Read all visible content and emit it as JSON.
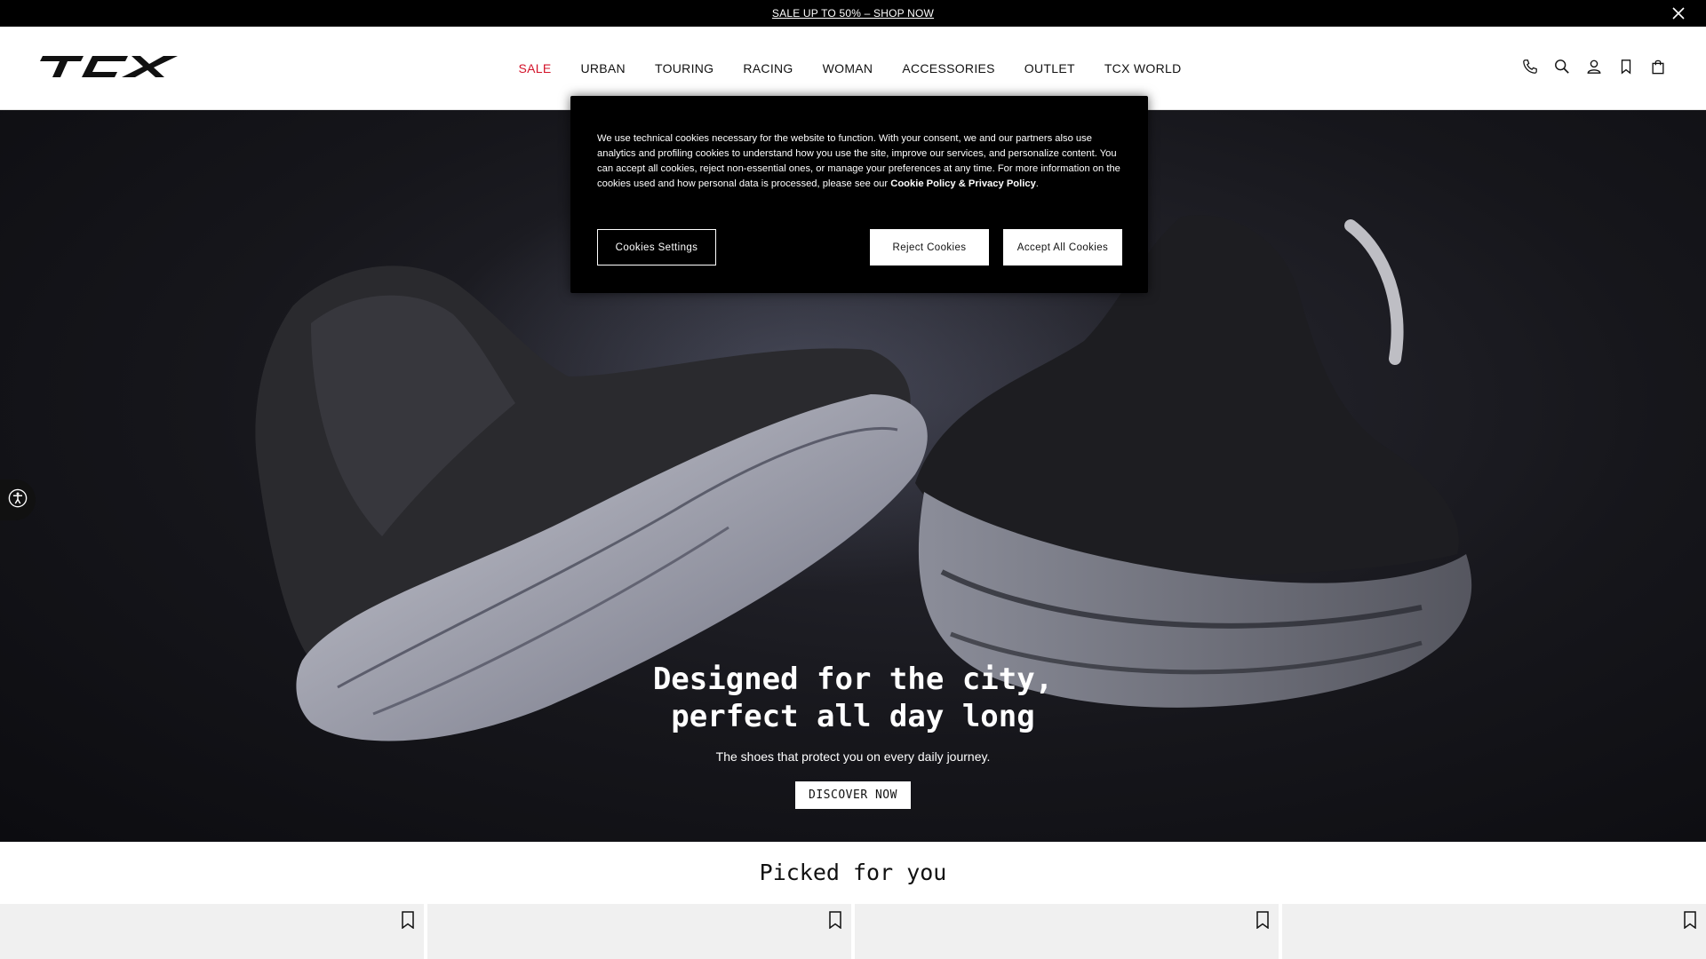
{
  "promo": {
    "text": "SALE UP TO 50% – SHOP NOW"
  },
  "header": {
    "logo_text": "TCX",
    "nav": [
      {
        "label": "SALE"
      },
      {
        "label": "URBAN"
      },
      {
        "label": "TOURING"
      },
      {
        "label": "RACING"
      },
      {
        "label": "WOMAN"
      },
      {
        "label": "ACCESSORIES"
      },
      {
        "label": "OUTLET"
      },
      {
        "label": "TCX WORLD"
      }
    ],
    "icons": [
      "phone-icon",
      "search-icon",
      "account-icon",
      "wishlist-icon",
      "bag-icon"
    ],
    "accent_color": "#d3132a"
  },
  "hero": {
    "title_line1": "Designed for the city,",
    "title_line2": "perfect all day long",
    "subtitle": "The shoes that protect you on every daily journey.",
    "cta": "DISCOVER NOW"
  },
  "cookie": {
    "text": "We use technical cookies necessary for the website to function. With your consent, we and our partners also use analytics and profiling cookies to understand how you use the site, improve our services, and personalize content. You can accept all cookies, reject non-essential ones, or manage your preferences at any time. For more information on the cookies used and how personal data is processed, please see our ",
    "link": "Cookie Policy & Privacy Policy",
    "settings": "Cookies Settings",
    "reject": "Reject Cookies",
    "accept": "Accept All Cookies"
  },
  "picked": {
    "title": "Picked for you"
  }
}
